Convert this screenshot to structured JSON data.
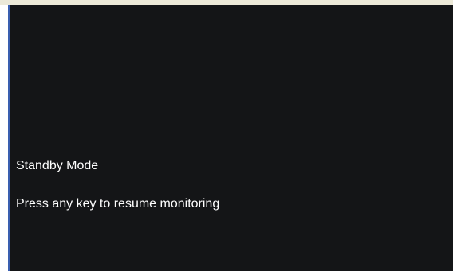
{
  "standby": {
    "title": "Standby Mode",
    "message": "Press any key to resume monitoring"
  },
  "colors": {
    "screen_background": "#141517",
    "text": "#ffffff",
    "left_border": "#3a5fb0",
    "top_strip": "#ece9d8"
  }
}
